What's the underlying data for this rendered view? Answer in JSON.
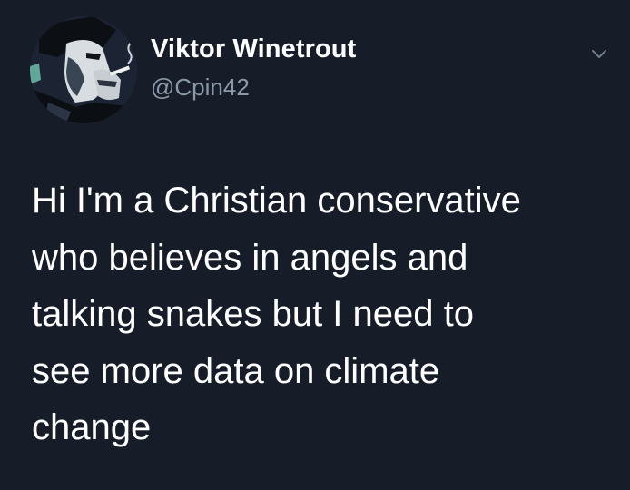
{
  "tweet": {
    "author": {
      "display_name": "Viktor Winetrout",
      "handle": "@Cpin42",
      "avatar_icon": "profile-photo-smoking-man"
    },
    "menu_icon": "chevron-down-icon",
    "text": "Hi I'm a Christian conservative\nwho believes in angels and\ntalking snakes but I need to\nsee more data on climate\nchange"
  },
  "colors": {
    "background": "#161d29",
    "primary_text": "#ffffff",
    "secondary_text": "#8a98a8",
    "chevron": "#6e7c8c"
  }
}
